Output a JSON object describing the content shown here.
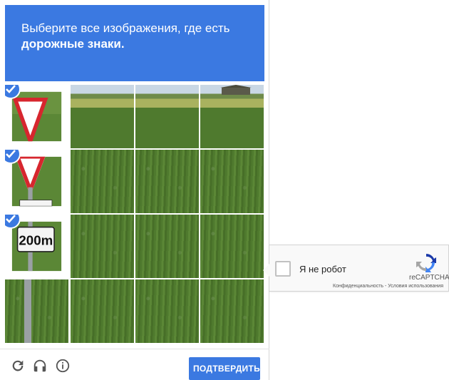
{
  "challenge": {
    "instruction_line1": "Выберите все изображения, где есть",
    "instruction_line2": "дорожные знаки.",
    "selected_tiles": [
      0,
      4,
      8
    ],
    "colors": {
      "accent": "#3b79e1",
      "sign_red": "#d7262e"
    },
    "sign_text": "200m"
  },
  "footer": {
    "reload_icon": "reload-icon",
    "audio_icon": "headphones-icon",
    "info_icon": "info-icon",
    "verify_label": "ПОДТВЕРДИТЬ"
  },
  "widget": {
    "checkbox_label": "Я не робот",
    "brand": "reCAPTCHA",
    "privacy": "Конфиденциальность",
    "separator": " - ",
    "terms": "Условия использования"
  }
}
